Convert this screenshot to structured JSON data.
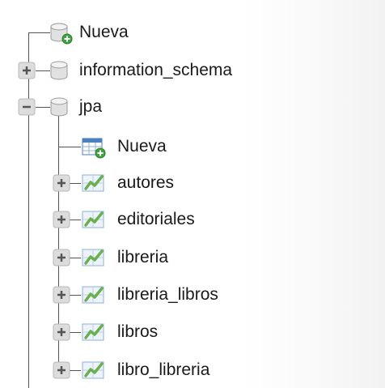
{
  "tree": {
    "root_new": {
      "label": "Nueva",
      "icon": "database-new-icon"
    },
    "information_schema": {
      "label": "information_schema",
      "expanded": false
    },
    "jpa": {
      "label": "jpa",
      "expanded": true,
      "new_table": {
        "label": "Nueva",
        "icon": "table-new-icon"
      },
      "tables": [
        {
          "label": "autores"
        },
        {
          "label": "editoriales"
        },
        {
          "label": "libreria"
        },
        {
          "label": "libreria_libros"
        },
        {
          "label": "libros"
        },
        {
          "label": "libro_libreria"
        }
      ]
    }
  },
  "colors": {
    "line": "#555555",
    "expander_bg": "#dcdcdc",
    "table_blue": "#4a7fc0",
    "table_green": "#6ab04c",
    "new_badge": "#3fa43f"
  }
}
